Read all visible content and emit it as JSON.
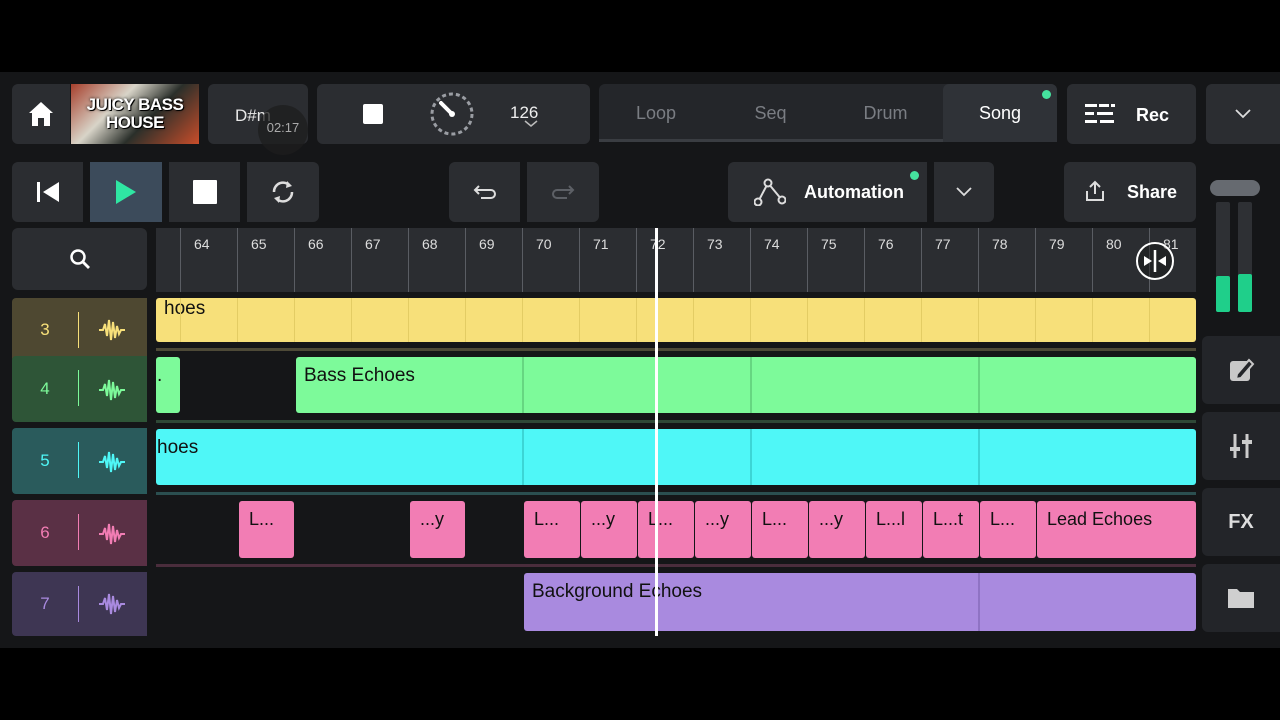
{
  "header": {
    "cover_line1": "JUICY BASS",
    "cover_line2": "HOUSE",
    "key": "D#m",
    "time": "02:17",
    "bpm": "126",
    "modes": [
      "Loop",
      "Seq",
      "Drum",
      "Song"
    ],
    "active_mode": "Song",
    "rec_label": "Rec"
  },
  "toolbar": {
    "automation_label": "Automation",
    "share_label": "Share"
  },
  "timeline": {
    "bars": [
      "64",
      "65",
      "66",
      "67",
      "68",
      "69",
      "70",
      "71",
      "72",
      "73",
      "74",
      "75",
      "76",
      "77",
      "78",
      "79",
      "80",
      "81"
    ],
    "playhead_bar": 72.35
  },
  "tracks": [
    {
      "number": "3",
      "color": "#f7e07a",
      "clip_labels": [
        "hoes"
      ]
    },
    {
      "number": "4",
      "color": "#7dfa9a",
      "clip_labels": [
        ".",
        "Bass Echoes"
      ]
    },
    {
      "number": "5",
      "color": "#4ff7f7",
      "clip_labels": [
        "hoes"
      ]
    },
    {
      "number": "6",
      "color": "#f27db4",
      "clip_labels": [
        "L...",
        "...y",
        "L...",
        "...y",
        "L...",
        "...y",
        "L...",
        "...y",
        "L...l",
        "L...t",
        "L...",
        "Lead Echoes"
      ]
    },
    {
      "number": "7",
      "color": "#a98adf",
      "clip_labels": [
        "Background Echoes"
      ]
    }
  ],
  "sidebar": {
    "fx_label": "FX",
    "meter_levels": [
      0.33,
      0.35
    ]
  }
}
